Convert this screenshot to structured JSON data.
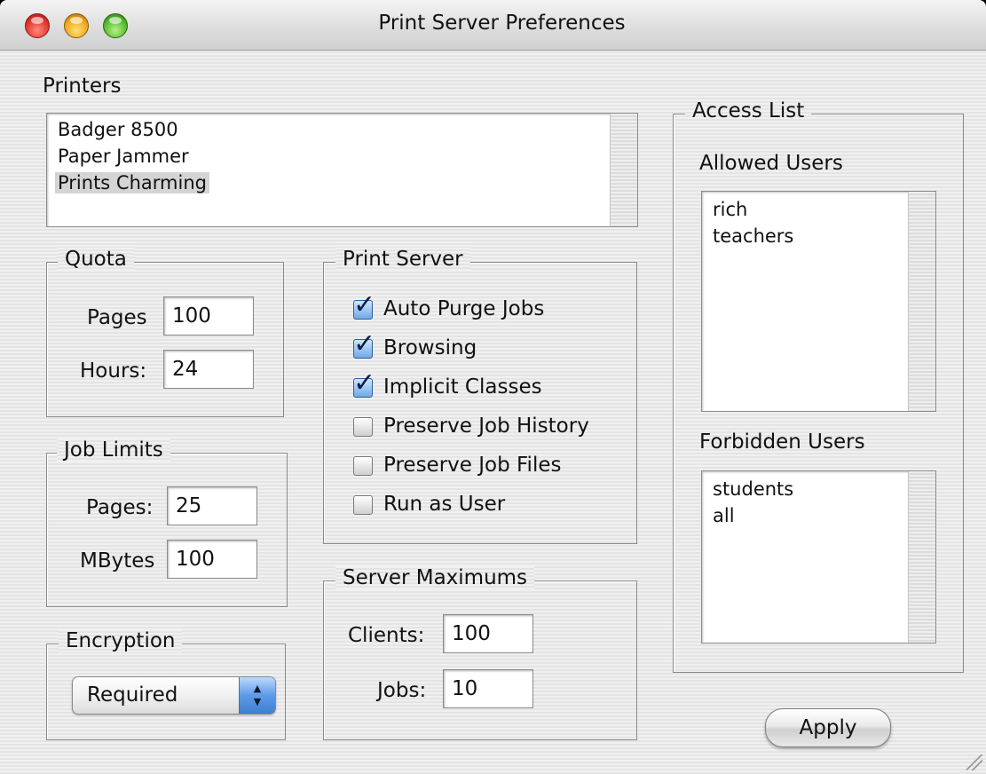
{
  "window": {
    "title": "Print Server Preferences"
  },
  "printers": {
    "label": "Printers",
    "items": [
      "Badger 8500",
      "Paper Jammer",
      "Prints Charming"
    ],
    "selected": "Prints Charming"
  },
  "quota": {
    "title": "Quota",
    "pages_label": "Pages",
    "pages_value": "100",
    "hours_label": "Hours:",
    "hours_value": "24"
  },
  "job_limits": {
    "title": "Job Limits",
    "pages_label": "Pages:",
    "pages_value": "25",
    "mbytes_label": "MBytes",
    "mbytes_value": "100"
  },
  "encryption": {
    "title": "Encryption",
    "selected": "Required"
  },
  "print_server": {
    "title": "Print Server",
    "options": [
      {
        "label": "Auto Purge Jobs",
        "checked": true
      },
      {
        "label": "Browsing",
        "checked": true
      },
      {
        "label": "Implicit Classes",
        "checked": true
      },
      {
        "label": "Preserve Job History",
        "checked": false
      },
      {
        "label": "Preserve Job Files",
        "checked": false
      },
      {
        "label": "Run as User",
        "checked": false
      }
    ]
  },
  "server_maximums": {
    "title": "Server Maximums",
    "clients_label": "Clients:",
    "clients_value": "100",
    "jobs_label": "Jobs:",
    "jobs_value": "10"
  },
  "access_list": {
    "title": "Access List",
    "allowed_label": "Allowed Users",
    "allowed_users": [
      "rich",
      "teachers"
    ],
    "forbidden_label": "Forbidden Users",
    "forbidden_users": [
      "students",
      "all"
    ]
  },
  "apply_label": "Apply",
  "colors": {
    "checkbox_accent": "#6fa9e6",
    "selection": "#d4d4d4"
  }
}
